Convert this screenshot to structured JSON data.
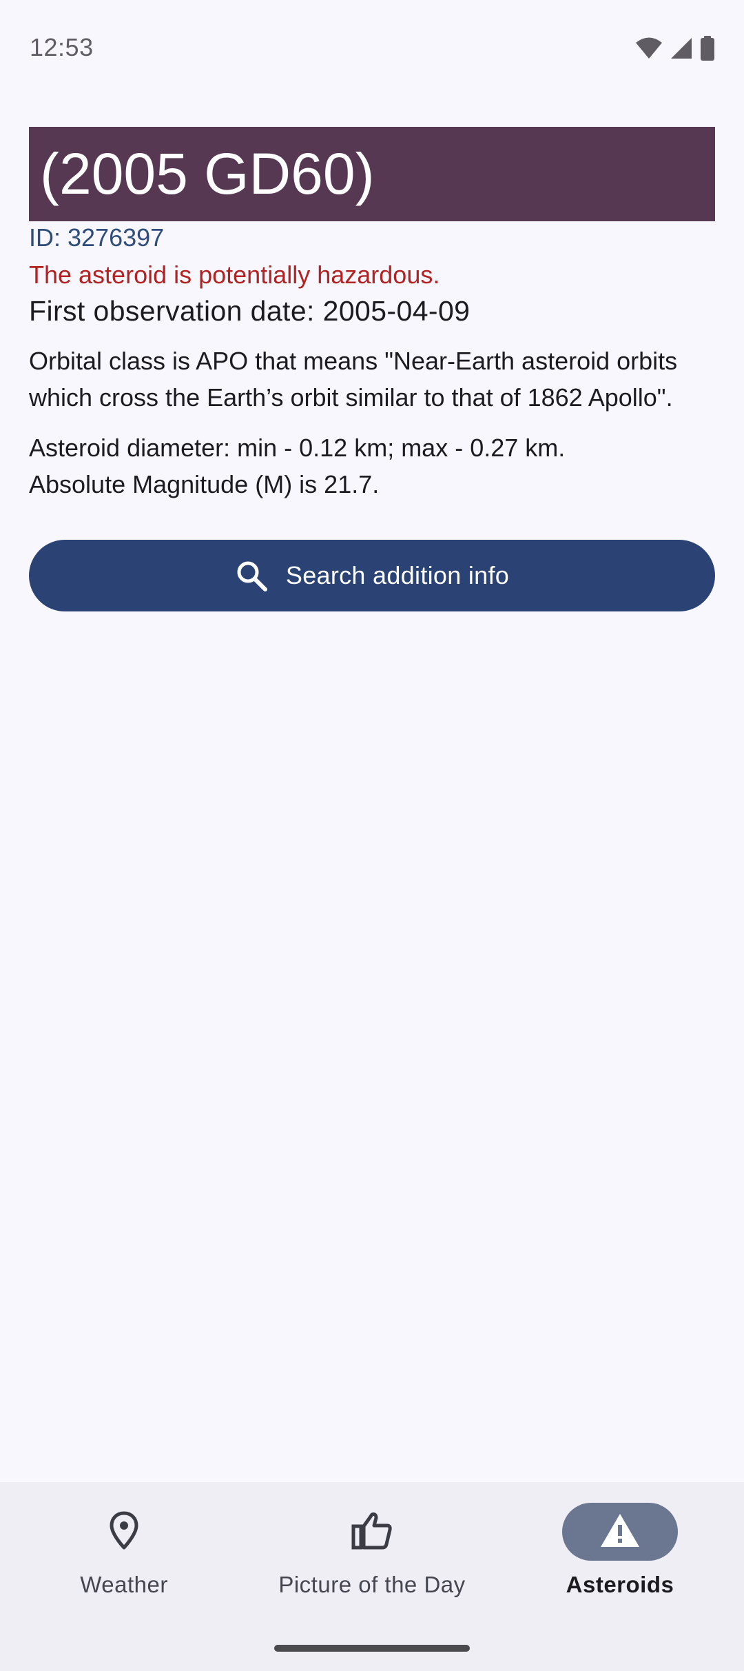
{
  "status_bar": {
    "time": "12:53",
    "icons": [
      "wifi-icon",
      "signal-icon",
      "battery-icon"
    ]
  },
  "asteroid": {
    "name": "(2005 GD60)",
    "id_text": "ID: 3276397",
    "hazard_text": "The asteroid is potentially hazardous.",
    "first_observation": "First observation date: 2005-04-09",
    "orbital_class": "Orbital class is APO that means \"Near-Earth asteroid orbits which cross the Earth’s orbit similar to that of 1862 Apollo\".",
    "diameter": "Asteroid diameter: min - 0.12 km; max - 0.27 km.",
    "magnitude": "Absolute Magnitude (M) is 21.7."
  },
  "search_button": {
    "label": "Search addition info",
    "icon": "search-icon"
  },
  "bottom_nav": {
    "items": [
      {
        "label": "Weather",
        "icon": "location-pin-icon",
        "active": false
      },
      {
        "label": "Picture of the Day",
        "icon": "thumbs-up-icon",
        "active": false
      },
      {
        "label": "Asteroids",
        "icon": "warning-icon",
        "active": true
      }
    ]
  },
  "colors": {
    "background": "#f8f7fe",
    "title_background": "#573852",
    "id_text": "#2f4d7a",
    "hazard_text": "#b22222",
    "button_background": "#2b4274",
    "nav_background": "#efeef4",
    "nav_active_pill": "#6b7691"
  }
}
